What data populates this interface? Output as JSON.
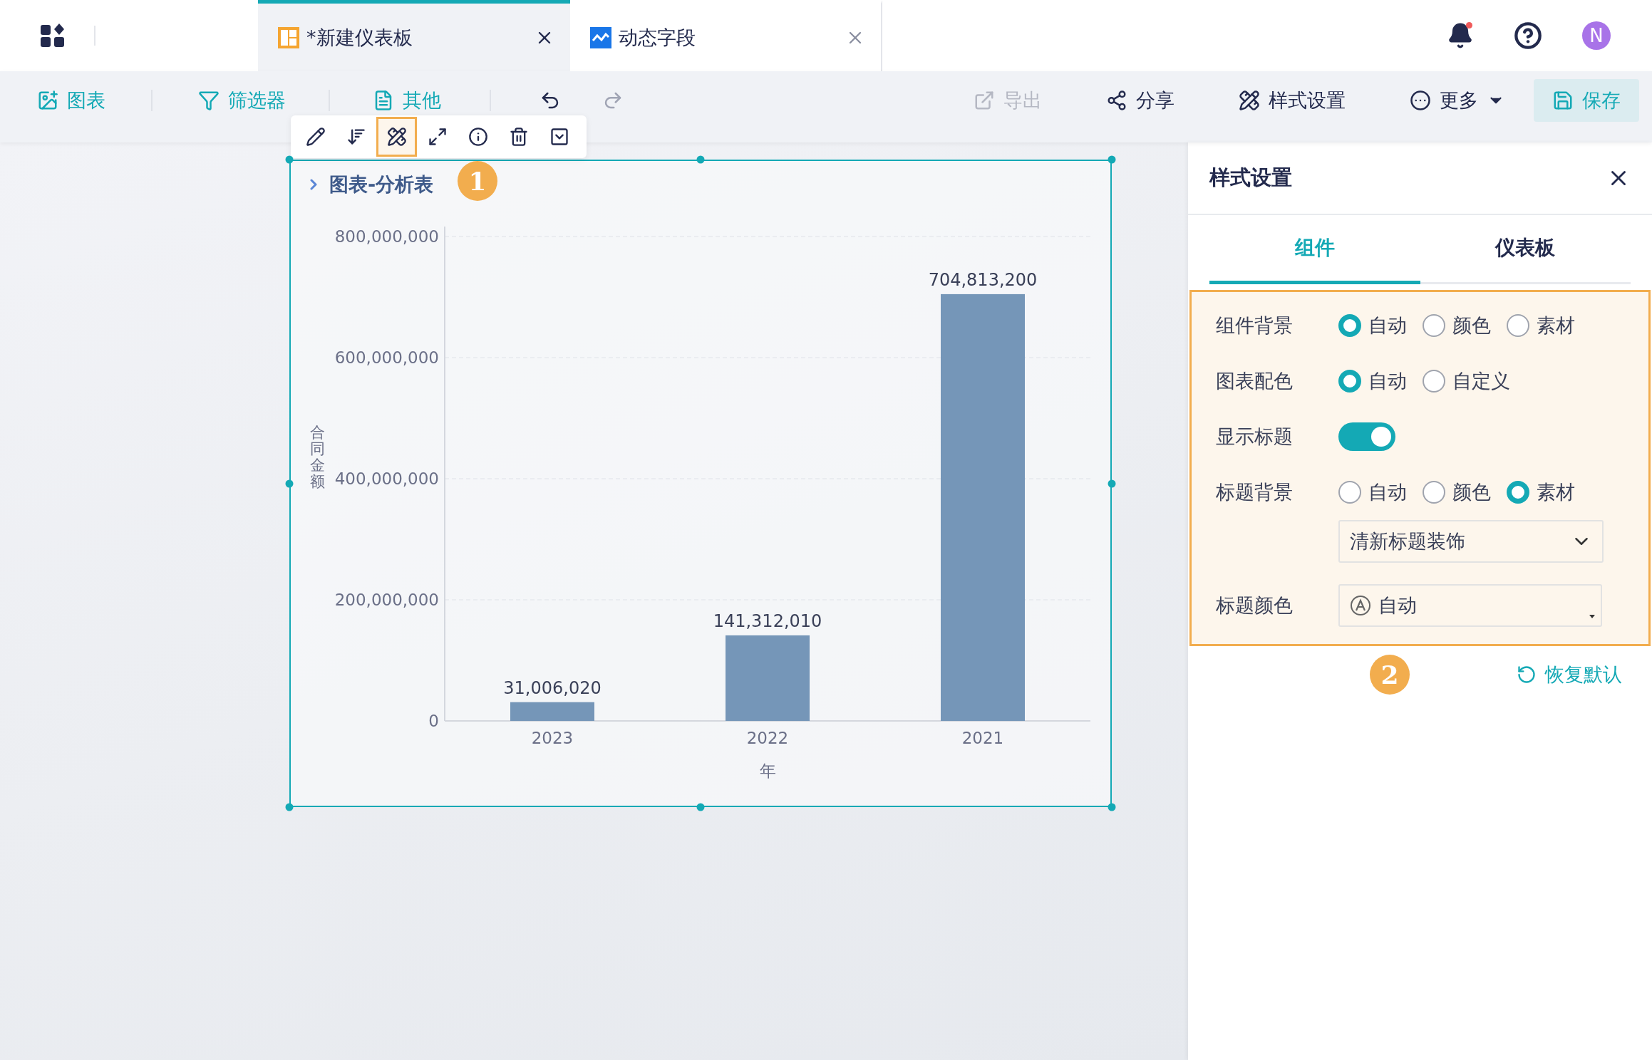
{
  "app_tabs": [
    {
      "label": "*新建仪表板",
      "selected": true,
      "kind": "dashboard"
    },
    {
      "label": "动态字段",
      "selected": false,
      "kind": "field"
    }
  ],
  "user": {
    "initial": "N"
  },
  "toolbar": {
    "left": [
      {
        "label": "图表",
        "kind": "chart"
      },
      {
        "label": "筛选器",
        "kind": "filter"
      },
      {
        "label": "其他",
        "kind": "other"
      }
    ],
    "right": [
      {
        "label": "导出",
        "kind": "export",
        "disabled": true
      },
      {
        "label": "分享",
        "kind": "share",
        "disabled": false
      },
      {
        "label": "样式设置",
        "kind": "style",
        "disabled": false
      },
      {
        "label": "更多",
        "kind": "more",
        "disabled": false
      }
    ],
    "save": "保存"
  },
  "widget_tools": [
    {
      "kind": "edit",
      "selected": false
    },
    {
      "kind": "sort",
      "selected": false
    },
    {
      "kind": "style",
      "selected": true
    },
    {
      "kind": "expand",
      "selected": false
    },
    {
      "kind": "info",
      "selected": false
    },
    {
      "kind": "delete",
      "selected": false
    },
    {
      "kind": "collapse",
      "selected": false
    }
  ],
  "callouts": [
    "1",
    "2"
  ],
  "widget": {
    "title": "图表-分析表",
    "chart_data": {
      "type": "bar",
      "grid": true,
      "xlabel": "年",
      "ylabel": "合同金额",
      "categories": [
        "2023",
        "2022",
        "2021"
      ],
      "values": [
        31006020,
        141312010,
        704813200
      ],
      "ylim": [
        0,
        800000000
      ],
      "yticks": [
        {
          "value": 0,
          "label": "0"
        },
        {
          "value": 200000000,
          "label": "200,000,000"
        },
        {
          "value": 400000000,
          "label": "400,000,000"
        },
        {
          "value": 600000000,
          "label": "600,000,000"
        },
        {
          "value": 800000000,
          "label": "800,000,000"
        }
      ],
      "value_labels": [
        "31,006,020",
        "141,312,010",
        "704,813,200"
      ]
    }
  },
  "panel": {
    "title": "样式设置",
    "tabs": [
      {
        "label": "组件",
        "selected": true
      },
      {
        "label": "仪表板",
        "selected": false
      }
    ],
    "settings": [
      {
        "kind": "radio",
        "label": "组件背景",
        "options": [
          {
            "label": "自动",
            "selected": true
          },
          {
            "label": "颜色",
            "selected": false
          },
          {
            "label": "素材",
            "selected": false
          }
        ]
      },
      {
        "kind": "radio",
        "label": "图表配色",
        "options": [
          {
            "label": "自动",
            "selected": true
          },
          {
            "label": "自定义",
            "selected": false
          }
        ]
      },
      {
        "kind": "toggle",
        "label": "显示标题",
        "on": true
      },
      {
        "kind": "radio",
        "label": "标题背景",
        "options": [
          {
            "label": "自动",
            "selected": false
          },
          {
            "label": "颜色",
            "selected": false
          },
          {
            "label": "素材",
            "selected": true
          }
        ],
        "select": {
          "value": "清新标题装饰"
        }
      },
      {
        "kind": "color",
        "label": "标题颜色",
        "value": "自动"
      }
    ],
    "reset": "恢复默认"
  }
}
